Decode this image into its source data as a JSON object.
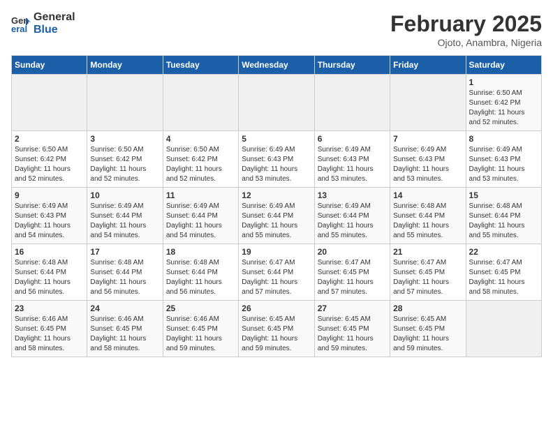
{
  "logo": {
    "line1": "General",
    "line2": "Blue"
  },
  "title": "February 2025",
  "subtitle": "Ojoto, Anambra, Nigeria",
  "headers": [
    "Sunday",
    "Monday",
    "Tuesday",
    "Wednesday",
    "Thursday",
    "Friday",
    "Saturday"
  ],
  "weeks": [
    [
      {
        "day": "",
        "info": ""
      },
      {
        "day": "",
        "info": ""
      },
      {
        "day": "",
        "info": ""
      },
      {
        "day": "",
        "info": ""
      },
      {
        "day": "",
        "info": ""
      },
      {
        "day": "",
        "info": ""
      },
      {
        "day": "1",
        "info": "Sunrise: 6:50 AM\nSunset: 6:42 PM\nDaylight: 11 hours\nand 52 minutes."
      }
    ],
    [
      {
        "day": "2",
        "info": "Sunrise: 6:50 AM\nSunset: 6:42 PM\nDaylight: 11 hours\nand 52 minutes."
      },
      {
        "day": "3",
        "info": "Sunrise: 6:50 AM\nSunset: 6:42 PM\nDaylight: 11 hours\nand 52 minutes."
      },
      {
        "day": "4",
        "info": "Sunrise: 6:50 AM\nSunset: 6:42 PM\nDaylight: 11 hours\nand 52 minutes."
      },
      {
        "day": "5",
        "info": "Sunrise: 6:49 AM\nSunset: 6:43 PM\nDaylight: 11 hours\nand 53 minutes."
      },
      {
        "day": "6",
        "info": "Sunrise: 6:49 AM\nSunset: 6:43 PM\nDaylight: 11 hours\nand 53 minutes."
      },
      {
        "day": "7",
        "info": "Sunrise: 6:49 AM\nSunset: 6:43 PM\nDaylight: 11 hours\nand 53 minutes."
      },
      {
        "day": "8",
        "info": "Sunrise: 6:49 AM\nSunset: 6:43 PM\nDaylight: 11 hours\nand 53 minutes."
      }
    ],
    [
      {
        "day": "9",
        "info": "Sunrise: 6:49 AM\nSunset: 6:43 PM\nDaylight: 11 hours\nand 54 minutes."
      },
      {
        "day": "10",
        "info": "Sunrise: 6:49 AM\nSunset: 6:44 PM\nDaylight: 11 hours\nand 54 minutes."
      },
      {
        "day": "11",
        "info": "Sunrise: 6:49 AM\nSunset: 6:44 PM\nDaylight: 11 hours\nand 54 minutes."
      },
      {
        "day": "12",
        "info": "Sunrise: 6:49 AM\nSunset: 6:44 PM\nDaylight: 11 hours\nand 55 minutes."
      },
      {
        "day": "13",
        "info": "Sunrise: 6:49 AM\nSunset: 6:44 PM\nDaylight: 11 hours\nand 55 minutes."
      },
      {
        "day": "14",
        "info": "Sunrise: 6:48 AM\nSunset: 6:44 PM\nDaylight: 11 hours\nand 55 minutes."
      },
      {
        "day": "15",
        "info": "Sunrise: 6:48 AM\nSunset: 6:44 PM\nDaylight: 11 hours\nand 55 minutes."
      }
    ],
    [
      {
        "day": "16",
        "info": "Sunrise: 6:48 AM\nSunset: 6:44 PM\nDaylight: 11 hours\nand 56 minutes."
      },
      {
        "day": "17",
        "info": "Sunrise: 6:48 AM\nSunset: 6:44 PM\nDaylight: 11 hours\nand 56 minutes."
      },
      {
        "day": "18",
        "info": "Sunrise: 6:48 AM\nSunset: 6:44 PM\nDaylight: 11 hours\nand 56 minutes."
      },
      {
        "day": "19",
        "info": "Sunrise: 6:47 AM\nSunset: 6:44 PM\nDaylight: 11 hours\nand 57 minutes."
      },
      {
        "day": "20",
        "info": "Sunrise: 6:47 AM\nSunset: 6:45 PM\nDaylight: 11 hours\nand 57 minutes."
      },
      {
        "day": "21",
        "info": "Sunrise: 6:47 AM\nSunset: 6:45 PM\nDaylight: 11 hours\nand 57 minutes."
      },
      {
        "day": "22",
        "info": "Sunrise: 6:47 AM\nSunset: 6:45 PM\nDaylight: 11 hours\nand 58 minutes."
      }
    ],
    [
      {
        "day": "23",
        "info": "Sunrise: 6:46 AM\nSunset: 6:45 PM\nDaylight: 11 hours\nand 58 minutes."
      },
      {
        "day": "24",
        "info": "Sunrise: 6:46 AM\nSunset: 6:45 PM\nDaylight: 11 hours\nand 58 minutes."
      },
      {
        "day": "25",
        "info": "Sunrise: 6:46 AM\nSunset: 6:45 PM\nDaylight: 11 hours\nand 59 minutes."
      },
      {
        "day": "26",
        "info": "Sunrise: 6:45 AM\nSunset: 6:45 PM\nDaylight: 11 hours\nand 59 minutes."
      },
      {
        "day": "27",
        "info": "Sunrise: 6:45 AM\nSunset: 6:45 PM\nDaylight: 11 hours\nand 59 minutes."
      },
      {
        "day": "28",
        "info": "Sunrise: 6:45 AM\nSunset: 6:45 PM\nDaylight: 11 hours\nand 59 minutes."
      },
      {
        "day": "",
        "info": ""
      }
    ]
  ]
}
